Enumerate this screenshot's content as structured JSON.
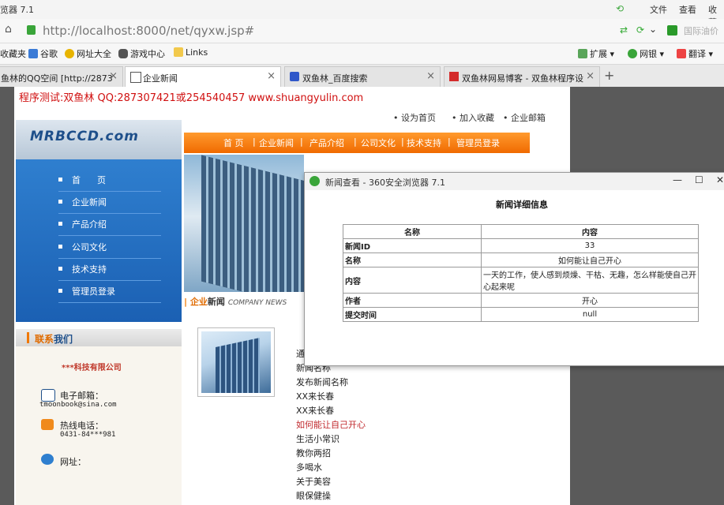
{
  "browser": {
    "title": "览器 7.1",
    "menu": [
      "文件",
      "查看",
      "收藏"
    ],
    "url": "http://localhost:8000/net/qyxw.jsp#",
    "bookmarks": [
      "收藏夹",
      "谷歌",
      "网址大全",
      "游戏中心",
      "Links"
    ],
    "bookmarks_right": [
      "扩展",
      "网银",
      "翻译"
    ],
    "search_hint": "国际油价",
    "tabs": [
      {
        "label": "鱼林的QQ空间 [http://2873"
      },
      {
        "label": "企业新闻"
      },
      {
        "label": "双鱼林_百度搜索"
      },
      {
        "label": "双鱼林网易博客 - 双鱼林程序设"
      }
    ]
  },
  "site": {
    "banner": "程序测试:双鱼林 QQ:287307421或254540457 www.shuangyulin.com",
    "logo": "MRBCCD.com",
    "top_links": [
      "设为首页",
      "加入收藏",
      "企业邮箱"
    ],
    "nav": [
      "首 页",
      "企业新闻",
      "产品介绍",
      "公司文化",
      "技术支持",
      "管理员登录"
    ],
    "sidebar": [
      "首      页",
      "企业新闻",
      "产品介绍",
      "公司文化",
      "技术支持",
      "管理员登录"
    ],
    "news_header": {
      "prefix": "企业",
      "main": "新闻",
      "en": "COMPANY NEWS"
    },
    "contact": {
      "title_a": "联系",
      "title_b": "我们",
      "company": "***科技有限公司",
      "email_label": "电子邮箱：",
      "email": "tmoonbook@sina.com",
      "phone_label": "热线电话：",
      "phone": "0431-84***981",
      "web_label": "网址："
    },
    "news_list": [
      "通",
      "新闻名称",
      "发布新闻名称",
      "XX来长春",
      "XX来长春",
      "如何能让自己开心",
      "生活小常识",
      "教你两招",
      "多喝水",
      "关于美容",
      "眼保健操"
    ]
  },
  "popup": {
    "title": "新闻查看 - 360安全浏览器 7.1",
    "heading": "新闻详细信息",
    "col_name": "名称",
    "col_content": "内容",
    "rows": [
      {
        "k": "新闻ID",
        "v": "33"
      },
      {
        "k": "名称",
        "v": "如何能让自己开心"
      },
      {
        "k": "内容",
        "v": "一天的工作，使人感到烦燥、干枯、无趣，怎么样能使自己开心起来呢"
      },
      {
        "k": "作者",
        "v": "开心"
      },
      {
        "k": "提交时间",
        "v": "null"
      }
    ]
  }
}
